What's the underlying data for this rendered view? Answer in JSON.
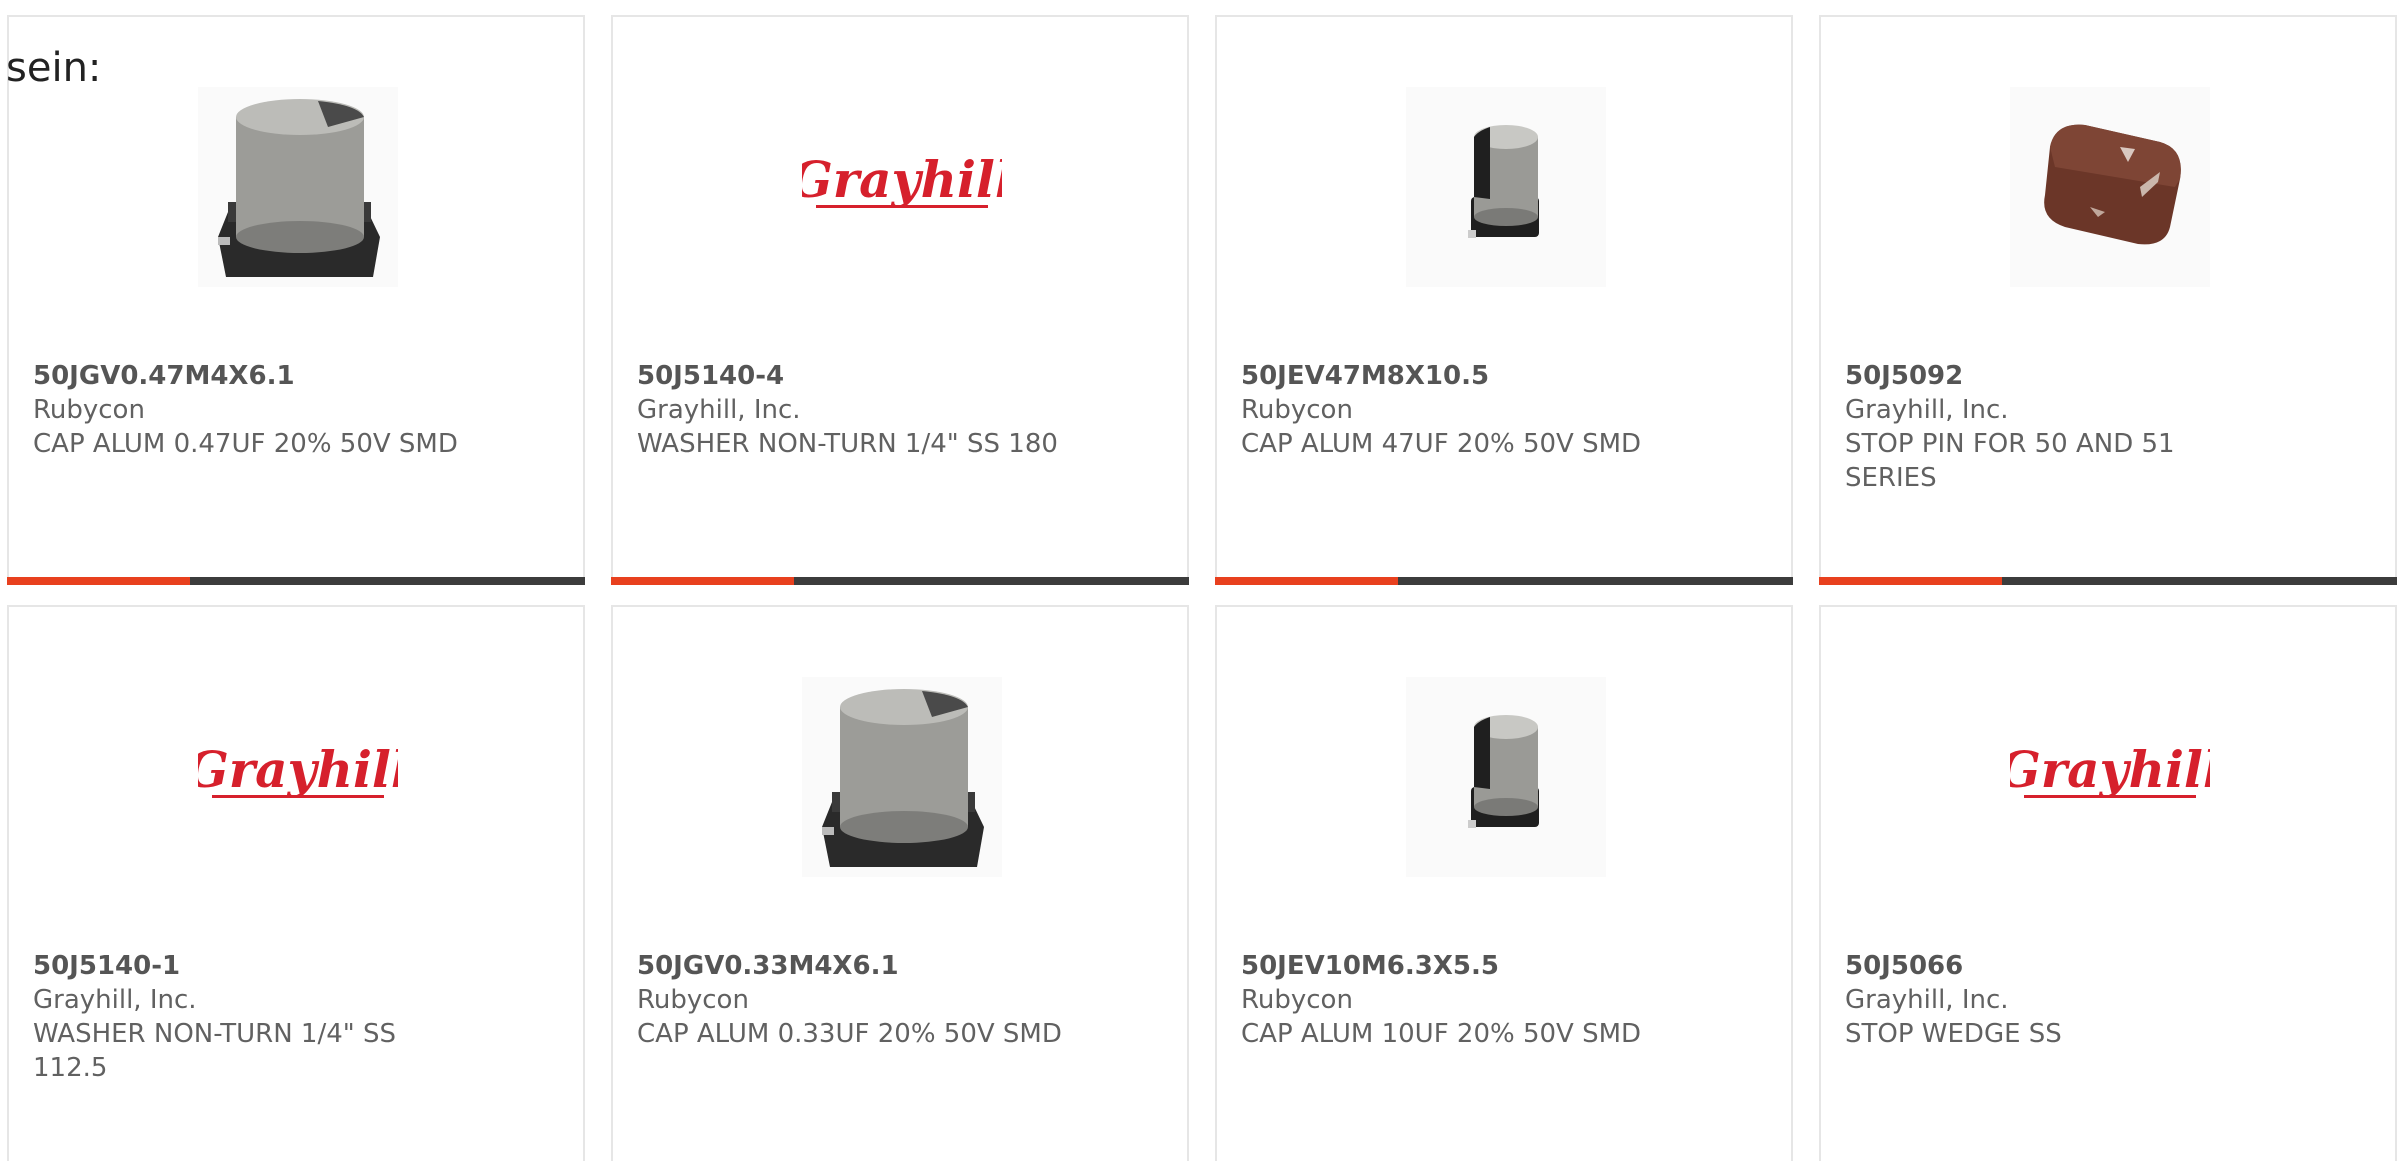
{
  "overlay": {
    "text": "sein:"
  },
  "colors": {
    "accent": "#e8401e",
    "bar": "#3c3c3c",
    "grayhill_red": "#d6202c"
  },
  "products": [
    {
      "part": "50JGV0.47M4X6.1",
      "maker": "Rubycon",
      "desc": "CAP ALUM 0.47UF 20% 50V SMD",
      "image": "large-capacitor-icon"
    },
    {
      "part": "50J5140-4",
      "maker": "Grayhill, Inc.",
      "desc": "WASHER NON-TURN 1/4\" SS 180",
      "image": "grayhill-logo"
    },
    {
      "part": "50JEV47M8X10.5",
      "maker": "Rubycon",
      "desc": "CAP ALUM 47UF 20% 50V SMD",
      "image": "small-capacitor-icon"
    },
    {
      "part": "50J5092",
      "maker": "Grayhill, Inc.",
      "desc": "STOP PIN FOR 50 AND 51\nSERIES",
      "image": "stop-pin-icon"
    },
    {
      "part": "50J5140-1",
      "maker": "Grayhill, Inc.",
      "desc": "WASHER NON-TURN 1/4\" SS\n112.5",
      "image": "grayhill-logo"
    },
    {
      "part": "50JGV0.33M4X6.1",
      "maker": "Rubycon",
      "desc": "CAP ALUM 0.33UF 20% 50V SMD",
      "image": "large-capacitor-icon"
    },
    {
      "part": "50JEV10M6.3X5.5",
      "maker": "Rubycon",
      "desc": "CAP ALUM 10UF 20% 50V SMD",
      "image": "small-capacitor-icon"
    },
    {
      "part": "50J5066",
      "maker": "Grayhill, Inc.",
      "desc": "STOP WEDGE SS",
      "image": "grayhill-logo"
    }
  ],
  "logo_text": "Grayhill"
}
